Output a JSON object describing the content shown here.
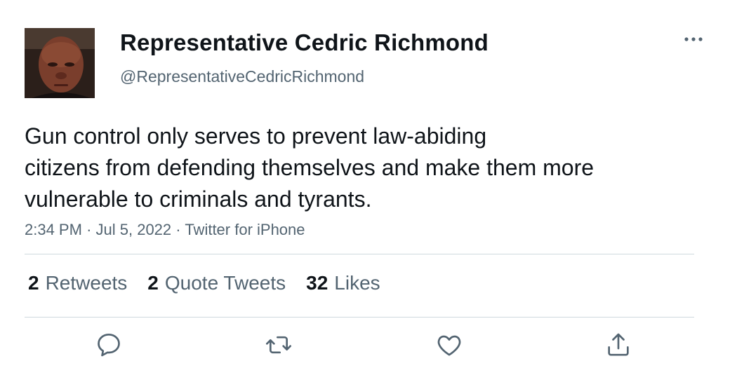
{
  "user": {
    "display_name": "Representative Cedric Richmond",
    "handle": "@RepresentativeCedricRichmond",
    "avatar": "profile-photo"
  },
  "tweet": {
    "lines": [
      "Gun control only serves to prevent law-abiding",
      "citizens from defending themselves and make them more",
      "vulnerable to criminals and tyrants."
    ],
    "time": "2:34 PM",
    "date": "Jul 5, 2022",
    "source": "Twitter for iPhone",
    "separator": "·"
  },
  "stats": {
    "retweets": {
      "count": "2",
      "label": "Retweets"
    },
    "quote_tweets": {
      "count": "2",
      "label": "Quote Tweets"
    },
    "likes": {
      "count": "32",
      "label": "Likes"
    }
  },
  "icons": {
    "more": "more-horizontal-icon",
    "reply": "reply-icon",
    "retweet": "retweet-icon",
    "like": "heart-icon",
    "share": "share-icon"
  },
  "colors": {
    "text_primary": "#0f1419",
    "text_secondary": "#536471",
    "divider": "#cfd9de"
  }
}
